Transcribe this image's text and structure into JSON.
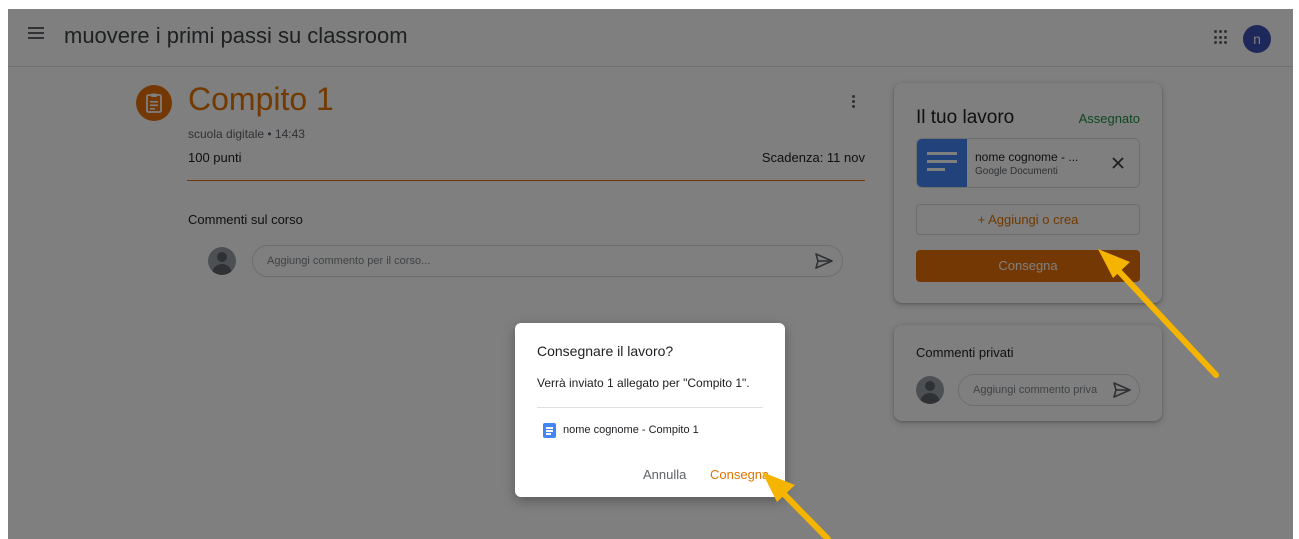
{
  "header": {
    "title": "muovere i primi passi su classroom",
    "menu_icon": "hamburger-menu-icon",
    "apps_icon": "apps-grid-icon",
    "avatar_letter": "n"
  },
  "assignment": {
    "icon": "assignment-icon",
    "title": "Compito 1",
    "meta": "scuola digitale • 14:43",
    "points": "100 punti",
    "due": "Scadenza: 11 nov",
    "class_comments_label": "Commenti sul corso",
    "class_comment_placeholder": "Aggiungi commento per il corso..."
  },
  "your_work": {
    "title": "Il tuo lavoro",
    "status": "Assegnato",
    "attachment": {
      "name": "nome cognome - ...",
      "type": "Google Documenti"
    },
    "add_button": "+ Aggiungi o crea",
    "turn_in_button": "Consegna"
  },
  "private_comments": {
    "title": "Commenti privati",
    "placeholder": "Aggiungi commento priva"
  },
  "dialog": {
    "title": "Consegnare il lavoro?",
    "body": "Verrà inviato 1 allegato per \"Compito 1\".",
    "file_name": "nome cognome - Compito 1",
    "cancel_label": "Annulla",
    "confirm_label": "Consegna"
  },
  "colors": {
    "accent": "#e8710a",
    "status_green": "#1e8e3e",
    "doc_blue": "#4285f4",
    "avatar_indigo": "#3f51b5",
    "annotation_arrow": "#f5b400"
  }
}
